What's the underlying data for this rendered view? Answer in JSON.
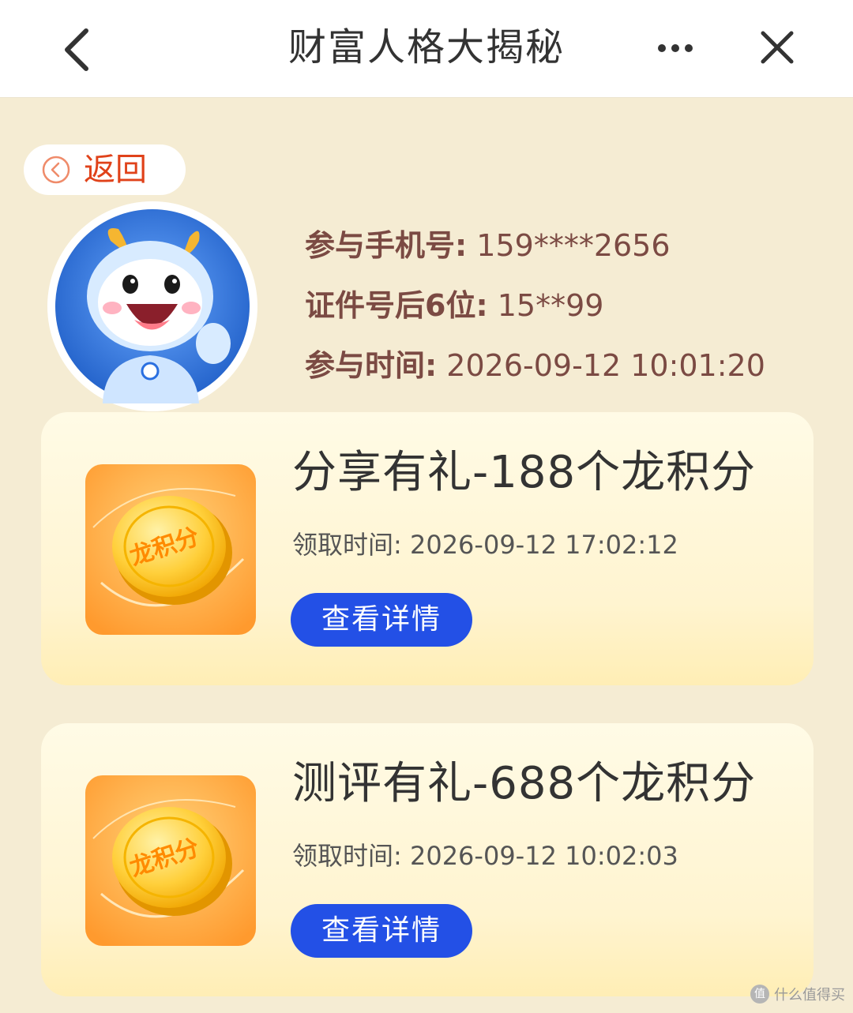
{
  "header": {
    "title": "财富人格大揭秘"
  },
  "back_pill": {
    "label": "返回"
  },
  "profile": {
    "rows": [
      {
        "key": "参与手机号:",
        "value": "159****2656"
      },
      {
        "key": "证件号后6位:",
        "value": "15**99"
      },
      {
        "key": "参与时间:",
        "value": "2026-09-12 10:01:20"
      }
    ]
  },
  "rewards": [
    {
      "title": "分享有礼-188个龙积分",
      "time_label": "领取时间:",
      "time_value": "2026-09-12 17:02:12",
      "button": "查看详情",
      "coin_text": "龙积分"
    },
    {
      "title": "测评有礼-688个龙积分",
      "time_label": "领取时间:",
      "time_value": "2026-09-12 10:02:03",
      "button": "查看详情",
      "coin_text": "龙积分"
    }
  ],
  "watermark": {
    "text": "什么值得买",
    "icon_text": "值"
  },
  "colors": {
    "background": "#f5ecd3",
    "accent_blue": "#2350e6",
    "back_red": "#e0421a",
    "info_brown": "#7b4a43"
  },
  "icons": {
    "back": "chevron-left-icon",
    "more": "more-dots-icon",
    "close": "close-icon",
    "back_pill": "circle-chevron-left-icon"
  }
}
